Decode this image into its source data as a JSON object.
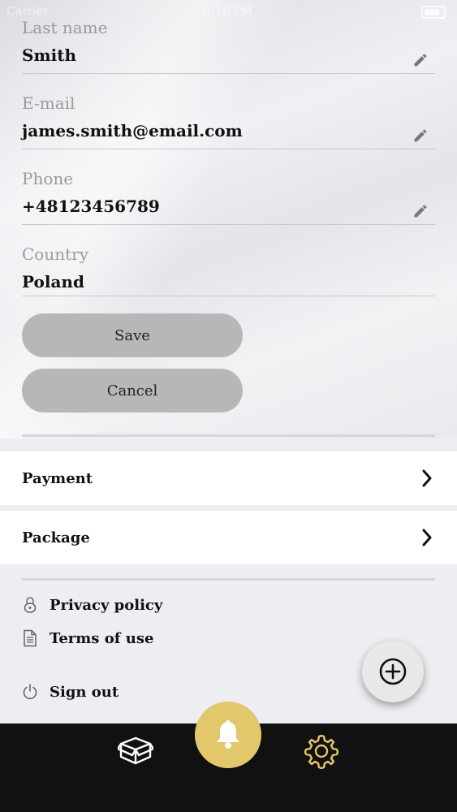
{
  "status_bar": {
    "carrier": "Carrier",
    "time": "8:16 PM"
  },
  "form": {
    "last_name": {
      "label": "Last name",
      "value": "Smith"
    },
    "email": {
      "label": "E-mail",
      "value": "james.smith@email.com"
    },
    "phone": {
      "label": "Phone",
      "value": "+48123456789"
    },
    "country": {
      "label": "Country",
      "value": "Poland"
    },
    "save_label": "Save",
    "cancel_label": "Cancel"
  },
  "menu": {
    "payment": "Payment",
    "package": "Package"
  },
  "links": {
    "privacy": "Privacy policy",
    "terms": "Terms of use",
    "sign_out": "Sign out"
  },
  "tabbar": {
    "left_icon": "box-icon",
    "center_icon": "bell-icon",
    "right_icon": "gear-icon",
    "accent": "#e2c76b"
  },
  "fab_icon": "plus-circle-icon"
}
